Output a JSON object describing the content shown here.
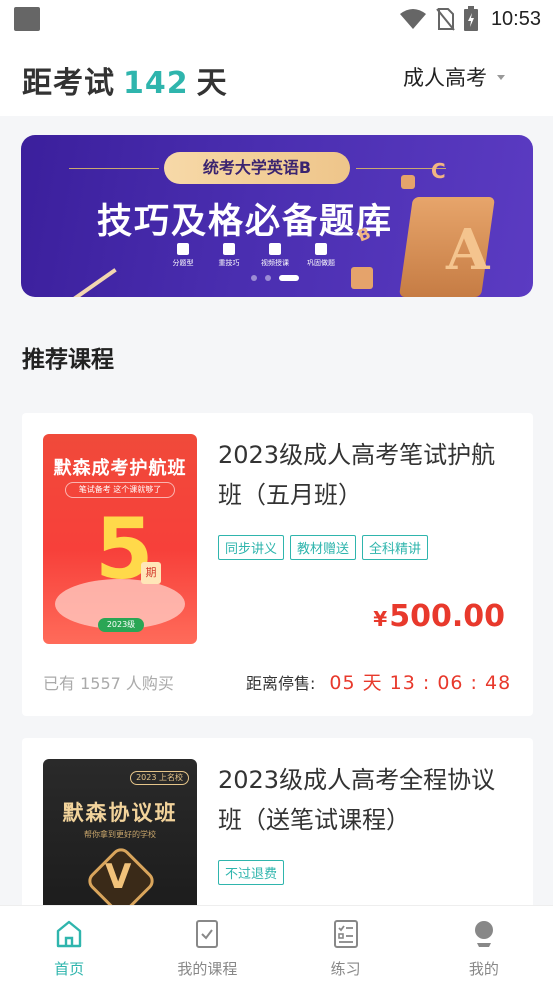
{
  "status_bar": {
    "time": "10:53"
  },
  "header": {
    "countdown_prefix": "距考试",
    "countdown_days": "142",
    "countdown_suffix": "天",
    "level": "成人高考"
  },
  "banner": {
    "pill": "统考大学英语B",
    "title": "技巧及格必备题库",
    "features": [
      "分题型",
      "重技巧",
      "视频授课",
      "巩固做题"
    ],
    "dots": 3,
    "active_dot": 3
  },
  "section_title": "推荐课程",
  "courses": [
    {
      "title": "2023级成人高考笔试护航班（五月班）",
      "cover": {
        "title": "默森成考护航班",
        "subtitle": "笔试备考 这个课就够了",
        "big_number": "5",
        "badge": "期",
        "year": "2023级"
      },
      "tags": [
        "同步讲义",
        "教材赠送",
        "全科精讲"
      ],
      "price": "500.00",
      "currency": "¥",
      "buyers": "已有 1557 人购买",
      "sale_end_label": "距离停售:",
      "timer": "05 天 13 : 06 : 48"
    },
    {
      "title": "2023级成人高考全程协议班（送笔试课程）",
      "cover": {
        "tag": "2023 上名校",
        "title": "默森协议班",
        "subtitle": "帮你拿到更好的学校"
      },
      "tags": [
        "不过退费"
      ]
    }
  ],
  "tabs": [
    {
      "label": "首页",
      "icon": "home-icon",
      "active": true
    },
    {
      "label": "我的课程",
      "icon": "course-book-icon",
      "active": false
    },
    {
      "label": "练习",
      "icon": "practice-list-icon",
      "active": false
    },
    {
      "label": "我的",
      "icon": "profile-icon",
      "active": false
    }
  ],
  "colors": {
    "accent": "#2fb5ad",
    "price": "#e8392c",
    "banner": "#4a2eb0"
  }
}
